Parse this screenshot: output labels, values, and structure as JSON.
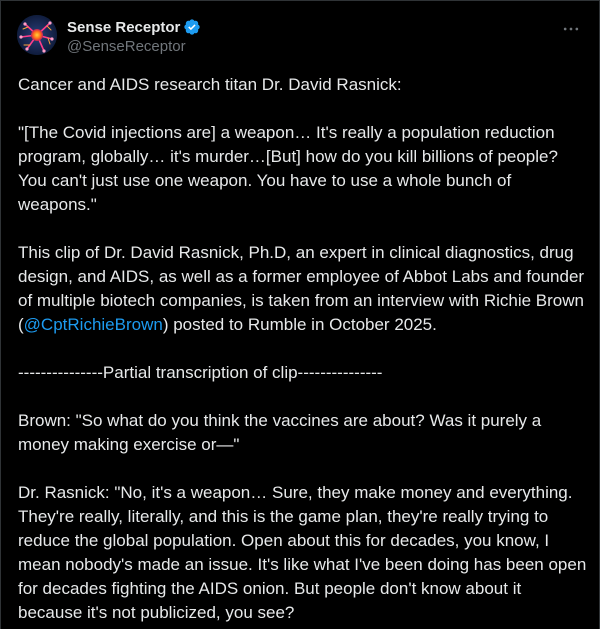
{
  "author": {
    "display_name": "Sense Receptor",
    "handle": "@SenseReceptor",
    "verified": true,
    "verified_color": "#1d9bf0"
  },
  "menu": {
    "icon": "more-horizontal-icon"
  },
  "post": {
    "intro": "Cancer and AIDS research titan Dr. David Rasnick:",
    "quote": "\"[The Covid injections are] a weapon… It's really a population reduction program, globally… it's murder…[But] how do you kill billions of people? You can't just use one weapon. You have to use a whole bunch of weapons.\"",
    "bio_before": "This clip of Dr. David Rasnick, Ph.D, an expert in clinical diagnostics, drug design, and AIDS, as well as a former employee of Abbot Labs and founder of multiple biotech companies, is taken from an interview with Richie Brown (",
    "mention": "@CptRichieBrown",
    "bio_after": ") posted to Rumble in October 2025.",
    "divider": "---------------Partial transcription of clip---------------",
    "brown_question": "Brown: \"So what do you think the vaccines are about? Was it purely a money making exercise or—\"",
    "rasnick_answer": "Dr. Rasnick: \"No, it's a weapon… Sure, they make money and everything. They're really, literally, and this is the game plan, they're really trying to reduce the global population. Open about this for decades, you know, I mean nobody's made an issue. It's like what I've been doing has been open for decades fighting the AIDS onion. But people don't know about it because it's not publicized,  you see?"
  },
  "colors": {
    "background": "#000000",
    "text": "#e7e9ea",
    "secondary_text": "#71767b",
    "accent": "#1d9bf0"
  }
}
